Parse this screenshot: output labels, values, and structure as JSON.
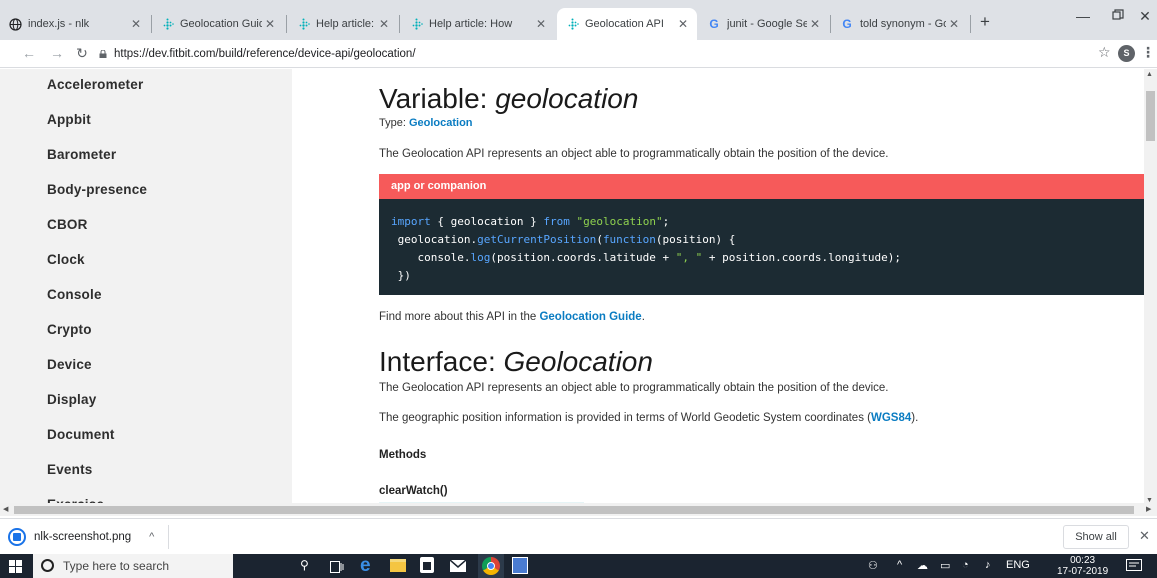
{
  "tabs": [
    {
      "title": "index.js - nlk",
      "icon": "globe-icon"
    },
    {
      "title": "Geolocation Guide",
      "icon": "fitbit-icon"
    },
    {
      "title": "Help article: Does",
      "icon": "fitbit-icon"
    },
    {
      "title": "Help article: How",
      "icon": "fitbit-icon"
    },
    {
      "title": "Geolocation API",
      "icon": "fitbit-icon"
    },
    {
      "title": "junit - Google Sea",
      "icon": "google-icon"
    },
    {
      "title": "told synonym - Go",
      "icon": "google-icon"
    }
  ],
  "address": {
    "url": "https://dev.fitbit.com/build/reference/device-api/geolocation/"
  },
  "profile": {
    "initial": "S"
  },
  "sidebar": {
    "items": [
      "Accelerometer",
      "Appbit",
      "Barometer",
      "Body-presence",
      "CBOR",
      "Clock",
      "Console",
      "Crypto",
      "Device",
      "Display",
      "Document",
      "Events",
      "Exercise"
    ]
  },
  "content": {
    "h1_prefix": "Variable: ",
    "h1_em": "geolocation",
    "type_label": "Type: ",
    "type_link": "Geolocation",
    "desc1": "The Geolocation API represents an object able to programmatically obtain the position of the device.",
    "code_header": "app or companion",
    "find_more_prefix": "Find more about this API in the ",
    "find_more_link": "Geolocation Guide",
    "find_more_suffix": ".",
    "h2_prefix": "Interface: ",
    "h2_em": "Geolocation",
    "desc2": "The Geolocation API represents an object able to programmatically obtain the position of the device.",
    "desc3_prefix": "The geographic position information is provided in terms of World Geodetic System coordinates (",
    "desc3_link": "WGS84",
    "desc3_suffix": ").",
    "methods_label": "Methods",
    "method1": "clearWatch()"
  },
  "download": {
    "filename": "nlk-screenshot.png",
    "show_all": "Show all"
  },
  "taskbar": {
    "search_placeholder": "Type here to search",
    "lang": "ENG",
    "time": "00:23",
    "date": "17-07-2019"
  }
}
